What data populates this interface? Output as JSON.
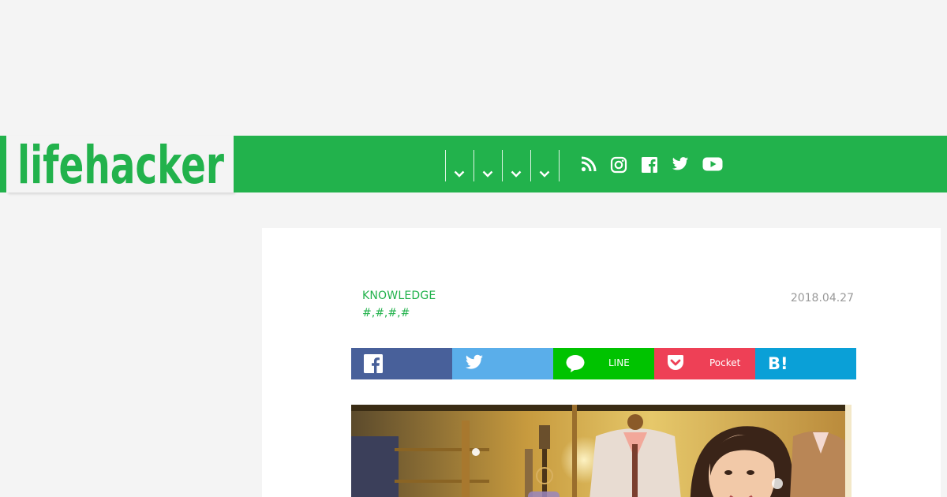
{
  "header": {
    "logo_text": "lifehacker",
    "nav_menu": [
      {
        "icon": "chevron-down-icon"
      },
      {
        "icon": "chevron-down-icon"
      },
      {
        "icon": "chevron-down-icon"
      },
      {
        "icon": "chevron-down-icon"
      }
    ],
    "social_icons": [
      "rss-icon",
      "instagram-icon",
      "facebook-icon",
      "twitter-icon",
      "youtube-icon"
    ]
  },
  "article": {
    "category": "KNOWLEDGE",
    "tags": [
      "#",
      "#",
      "#",
      "#"
    ],
    "date": "2018.04.27",
    "share": {
      "facebook_label": "",
      "twitter_label": "",
      "line_label": "LINE",
      "pocket_label": "Pocket",
      "hatena_label": ""
    }
  },
  "colors": {
    "brand_green": "#22b24c",
    "facebook": "#48609a",
    "twitter": "#5aaeea",
    "line": "#00c300",
    "pocket": "#ee4056",
    "hatena": "#0aa0d7"
  }
}
